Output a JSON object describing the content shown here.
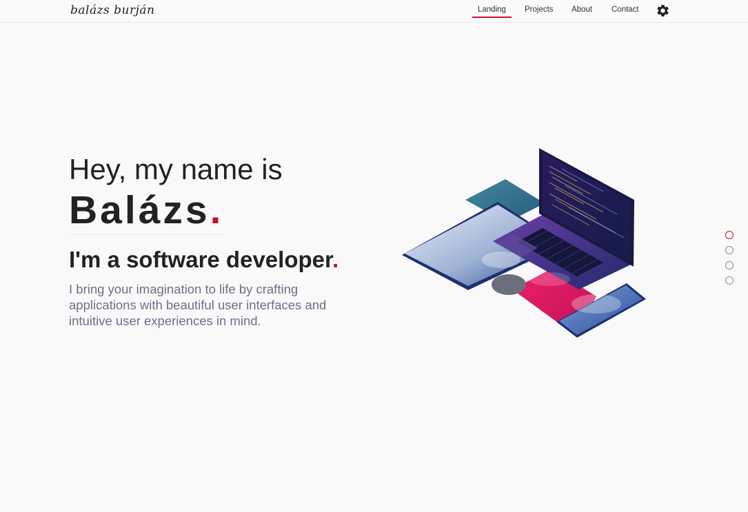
{
  "header": {
    "logo": "balázs burján",
    "nav": [
      {
        "label": "Landing",
        "active": true
      },
      {
        "label": "Projects",
        "active": false
      },
      {
        "label": "About",
        "active": false
      },
      {
        "label": "Contact",
        "active": false
      }
    ],
    "settings_icon": "gear-icon"
  },
  "hero": {
    "line1": "Hey, my name is",
    "name": "Balázs",
    "name_dot": ".",
    "line3_prefix": "I'm a ",
    "line3_bold": "software developer",
    "line3_dot": ".",
    "description": "I bring your imagination to life by crafting applications with beautiful user interfaces and intuitive user experiences in mind."
  },
  "illustration_icon": "isometric-devices-illustration",
  "section_nav": {
    "count": 4,
    "active_index": 0
  },
  "colors": {
    "accent": "#c8102e",
    "background": "#f9f9f9",
    "text": "#222222",
    "muted": "#6c6f86"
  }
}
